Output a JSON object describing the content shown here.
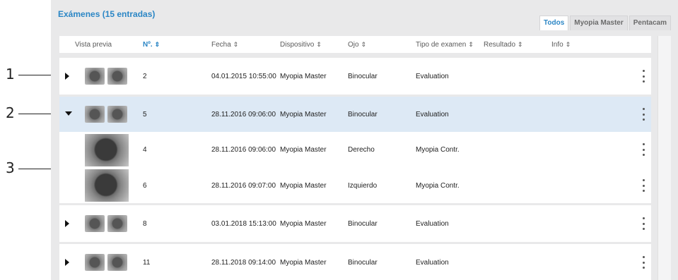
{
  "callouts": [
    "1",
    "2",
    "3"
  ],
  "panel": {
    "title": "Exámenes (15 entradas)"
  },
  "tabs": [
    {
      "label": "Todos",
      "active": true
    },
    {
      "label": "Myopia Master",
      "active": false
    },
    {
      "label": "Pentacam",
      "active": false
    }
  ],
  "columns": {
    "preview": "Vista previa",
    "number": "Nº.",
    "date": "Fecha",
    "device": "Dispositivo",
    "eye": "Ojo",
    "exam_type": "Tipo de examen",
    "result": "Resultado",
    "info": "Info",
    "sort_icon": "⇕"
  },
  "rows": [
    {
      "number": "2",
      "date": "04.01.2015 10:55:00",
      "device": "Myopia Master",
      "eye": "Binocular",
      "exam_type": "Evaluation",
      "expanded": false
    },
    {
      "number": "5",
      "date": "28.11.2016 09:06:00",
      "device": "Myopia Master",
      "eye": "Binocular",
      "exam_type": "Evaluation",
      "expanded": true,
      "children": [
        {
          "number": "4",
          "date": "28.11.2016 09:06:00",
          "device": "Myopia Master",
          "eye": "Derecho",
          "exam_type": "Myopia Contr."
        },
        {
          "number": "6",
          "date": "28.11.2016 09:07:00",
          "device": "Myopia Master",
          "eye": "Izquierdo",
          "exam_type": "Myopia Contr."
        }
      ]
    },
    {
      "number": "8",
      "date": "03.01.2018 15:13:00",
      "device": "Myopia Master",
      "eye": "Binocular",
      "exam_type": "Evaluation",
      "expanded": false
    },
    {
      "number": "11",
      "date": "28.11.2018 09:14:00",
      "device": "Myopia Master",
      "eye": "Binocular",
      "exam_type": "Evaluation",
      "expanded": false
    }
  ],
  "colors": {
    "accent": "#2b86c5",
    "selected_row": "#dde9f5",
    "marker": "#d0122b"
  },
  "icons": {
    "expand": "triangle-right-icon",
    "collapse": "triangle-down-icon",
    "menu": "kebab-menu-icon",
    "sort": "sort-arrows-icon"
  }
}
